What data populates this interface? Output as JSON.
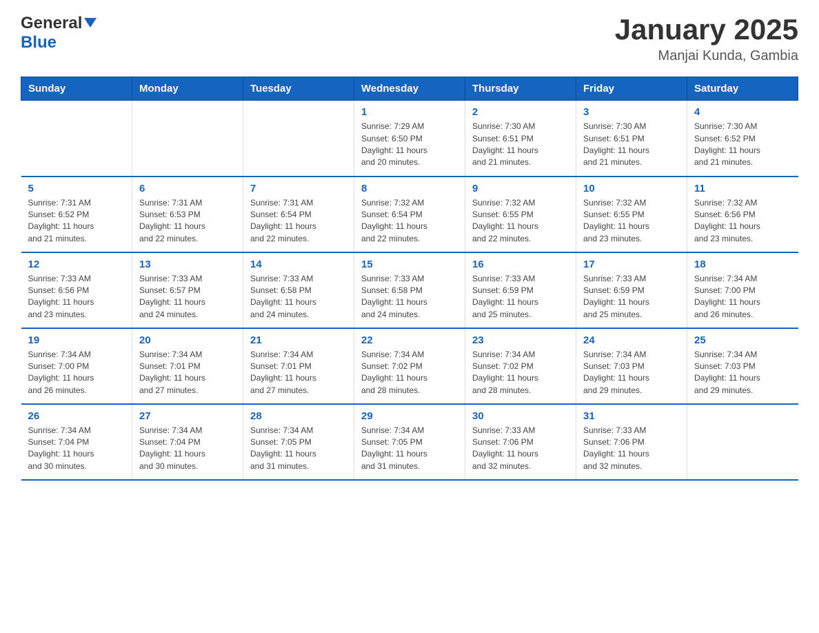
{
  "header": {
    "logo_general": "General",
    "logo_blue": "Blue",
    "title": "January 2025",
    "subtitle": "Manjai Kunda, Gambia"
  },
  "days_of_week": [
    "Sunday",
    "Monday",
    "Tuesday",
    "Wednesday",
    "Thursday",
    "Friday",
    "Saturday"
  ],
  "weeks": [
    [
      {
        "day": "",
        "info": ""
      },
      {
        "day": "",
        "info": ""
      },
      {
        "day": "",
        "info": ""
      },
      {
        "day": "1",
        "info": "Sunrise: 7:29 AM\nSunset: 6:50 PM\nDaylight: 11 hours\nand 20 minutes."
      },
      {
        "day": "2",
        "info": "Sunrise: 7:30 AM\nSunset: 6:51 PM\nDaylight: 11 hours\nand 21 minutes."
      },
      {
        "day": "3",
        "info": "Sunrise: 7:30 AM\nSunset: 6:51 PM\nDaylight: 11 hours\nand 21 minutes."
      },
      {
        "day": "4",
        "info": "Sunrise: 7:30 AM\nSunset: 6:52 PM\nDaylight: 11 hours\nand 21 minutes."
      }
    ],
    [
      {
        "day": "5",
        "info": "Sunrise: 7:31 AM\nSunset: 6:52 PM\nDaylight: 11 hours\nand 21 minutes."
      },
      {
        "day": "6",
        "info": "Sunrise: 7:31 AM\nSunset: 6:53 PM\nDaylight: 11 hours\nand 22 minutes."
      },
      {
        "day": "7",
        "info": "Sunrise: 7:31 AM\nSunset: 6:54 PM\nDaylight: 11 hours\nand 22 minutes."
      },
      {
        "day": "8",
        "info": "Sunrise: 7:32 AM\nSunset: 6:54 PM\nDaylight: 11 hours\nand 22 minutes."
      },
      {
        "day": "9",
        "info": "Sunrise: 7:32 AM\nSunset: 6:55 PM\nDaylight: 11 hours\nand 22 minutes."
      },
      {
        "day": "10",
        "info": "Sunrise: 7:32 AM\nSunset: 6:55 PM\nDaylight: 11 hours\nand 23 minutes."
      },
      {
        "day": "11",
        "info": "Sunrise: 7:32 AM\nSunset: 6:56 PM\nDaylight: 11 hours\nand 23 minutes."
      }
    ],
    [
      {
        "day": "12",
        "info": "Sunrise: 7:33 AM\nSunset: 6:56 PM\nDaylight: 11 hours\nand 23 minutes."
      },
      {
        "day": "13",
        "info": "Sunrise: 7:33 AM\nSunset: 6:57 PM\nDaylight: 11 hours\nand 24 minutes."
      },
      {
        "day": "14",
        "info": "Sunrise: 7:33 AM\nSunset: 6:58 PM\nDaylight: 11 hours\nand 24 minutes."
      },
      {
        "day": "15",
        "info": "Sunrise: 7:33 AM\nSunset: 6:58 PM\nDaylight: 11 hours\nand 24 minutes."
      },
      {
        "day": "16",
        "info": "Sunrise: 7:33 AM\nSunset: 6:59 PM\nDaylight: 11 hours\nand 25 minutes."
      },
      {
        "day": "17",
        "info": "Sunrise: 7:33 AM\nSunset: 6:59 PM\nDaylight: 11 hours\nand 25 minutes."
      },
      {
        "day": "18",
        "info": "Sunrise: 7:34 AM\nSunset: 7:00 PM\nDaylight: 11 hours\nand 26 minutes."
      }
    ],
    [
      {
        "day": "19",
        "info": "Sunrise: 7:34 AM\nSunset: 7:00 PM\nDaylight: 11 hours\nand 26 minutes."
      },
      {
        "day": "20",
        "info": "Sunrise: 7:34 AM\nSunset: 7:01 PM\nDaylight: 11 hours\nand 27 minutes."
      },
      {
        "day": "21",
        "info": "Sunrise: 7:34 AM\nSunset: 7:01 PM\nDaylight: 11 hours\nand 27 minutes."
      },
      {
        "day": "22",
        "info": "Sunrise: 7:34 AM\nSunset: 7:02 PM\nDaylight: 11 hours\nand 28 minutes."
      },
      {
        "day": "23",
        "info": "Sunrise: 7:34 AM\nSunset: 7:02 PM\nDaylight: 11 hours\nand 28 minutes."
      },
      {
        "day": "24",
        "info": "Sunrise: 7:34 AM\nSunset: 7:03 PM\nDaylight: 11 hours\nand 29 minutes."
      },
      {
        "day": "25",
        "info": "Sunrise: 7:34 AM\nSunset: 7:03 PM\nDaylight: 11 hours\nand 29 minutes."
      }
    ],
    [
      {
        "day": "26",
        "info": "Sunrise: 7:34 AM\nSunset: 7:04 PM\nDaylight: 11 hours\nand 30 minutes."
      },
      {
        "day": "27",
        "info": "Sunrise: 7:34 AM\nSunset: 7:04 PM\nDaylight: 11 hours\nand 30 minutes."
      },
      {
        "day": "28",
        "info": "Sunrise: 7:34 AM\nSunset: 7:05 PM\nDaylight: 11 hours\nand 31 minutes."
      },
      {
        "day": "29",
        "info": "Sunrise: 7:34 AM\nSunset: 7:05 PM\nDaylight: 11 hours\nand 31 minutes."
      },
      {
        "day": "30",
        "info": "Sunrise: 7:33 AM\nSunset: 7:06 PM\nDaylight: 11 hours\nand 32 minutes."
      },
      {
        "day": "31",
        "info": "Sunrise: 7:33 AM\nSunset: 7:06 PM\nDaylight: 11 hours\nand 32 minutes."
      },
      {
        "day": "",
        "info": ""
      }
    ]
  ]
}
